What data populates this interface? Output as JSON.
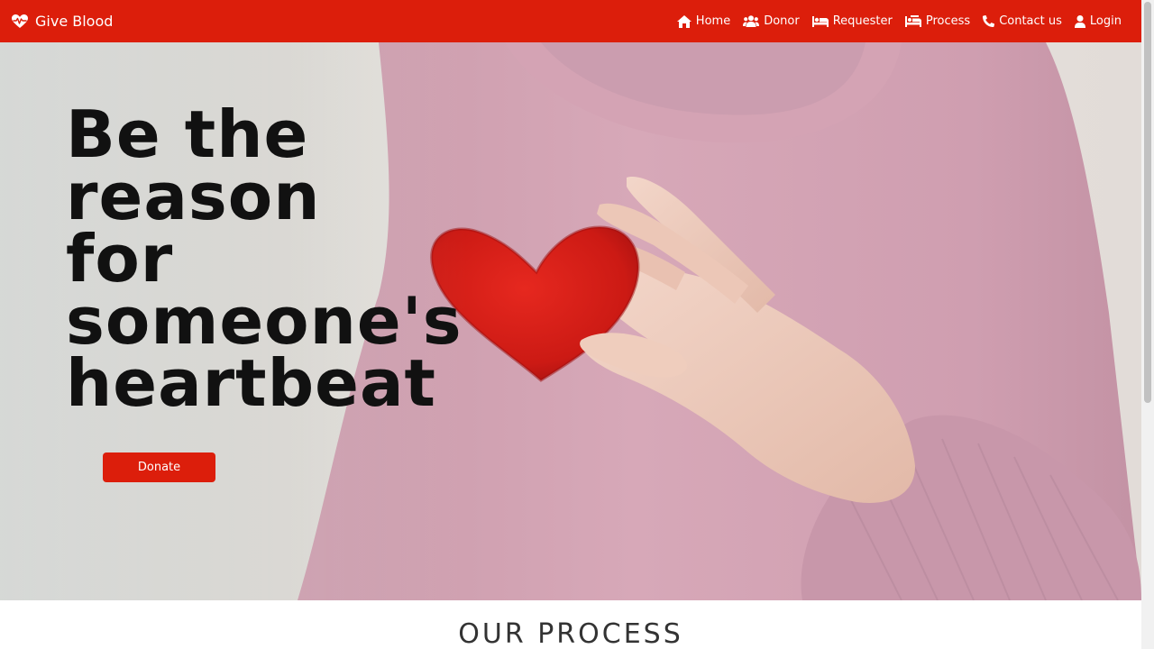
{
  "brand": {
    "name": "Give Blood",
    "icon": "heartbeat-icon"
  },
  "nav": {
    "items": [
      {
        "label": "Home",
        "icon": "home-icon"
      },
      {
        "label": "Donor",
        "icon": "users-icon"
      },
      {
        "label": "Requester",
        "icon": "bed-icon"
      },
      {
        "label": "Process",
        "icon": "procedures-icon"
      },
      {
        "label": "Contact us",
        "icon": "phone-icon"
      },
      {
        "label": "Login",
        "icon": "user-icon"
      }
    ]
  },
  "hero": {
    "headline": "Be the reason for someone's heartbeat",
    "cta_label": "Donate"
  },
  "sections": {
    "process_title": "OUR PROCESS"
  },
  "colors": {
    "primary": "#dc1e0b",
    "nav_text": "#ffffff",
    "headline": "#111111"
  }
}
